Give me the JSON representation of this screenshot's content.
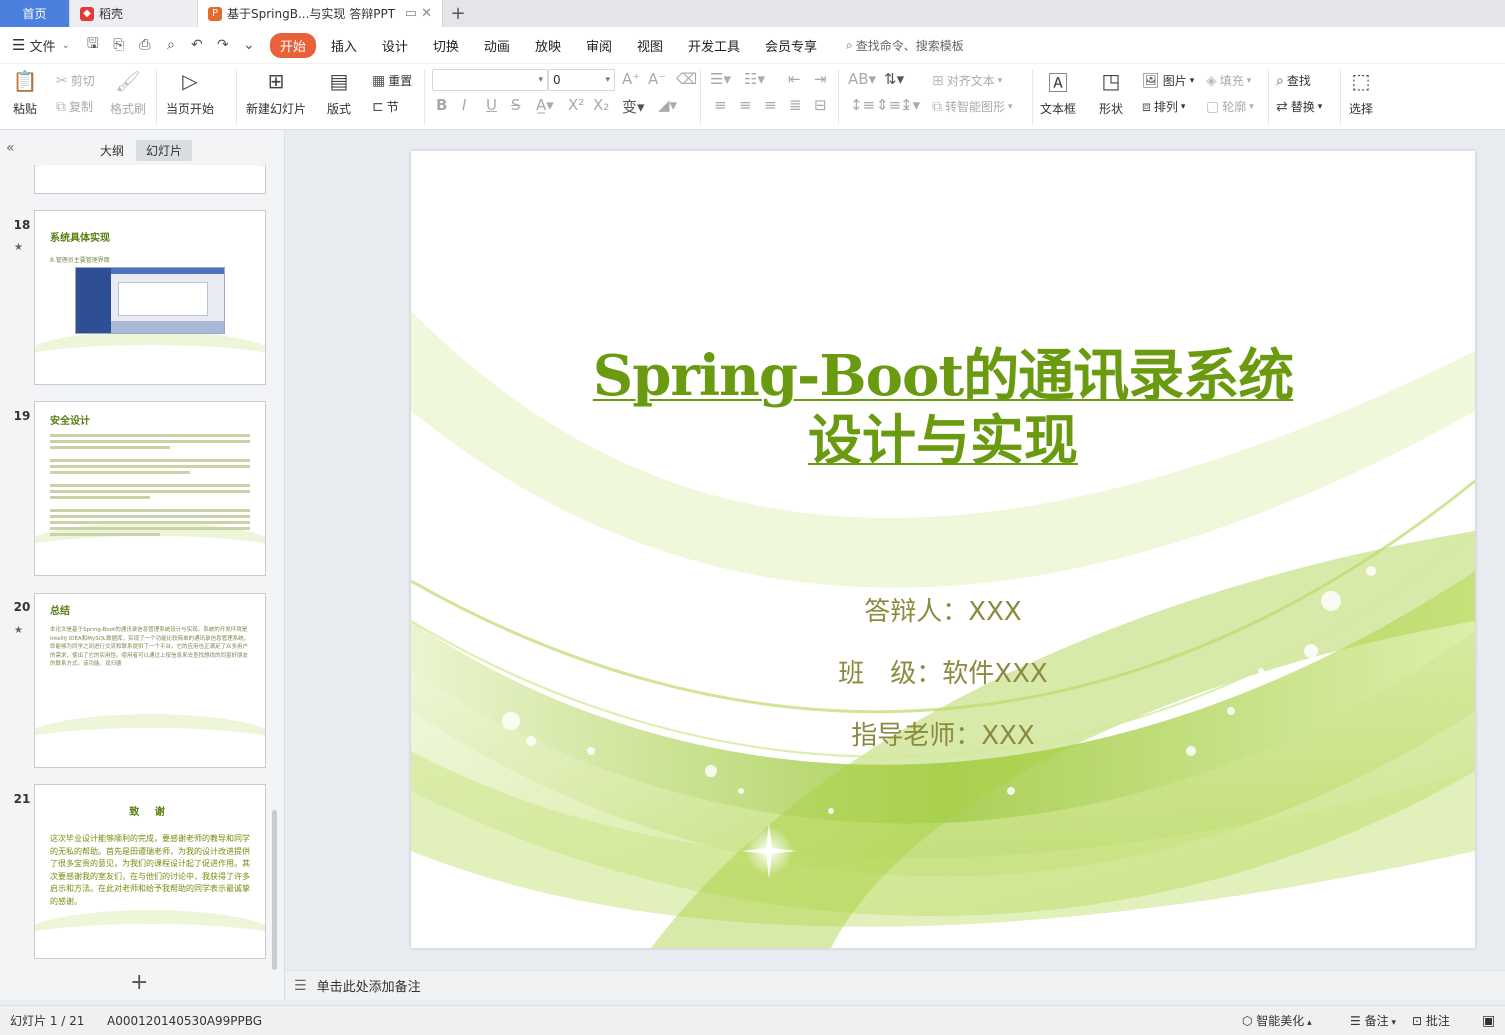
{
  "tabs": {
    "home": "首页",
    "docer": "稻壳",
    "doc": "基于SpringB...与实现 答辩PPT"
  },
  "menu": {
    "file": "文件",
    "tabs": [
      "开始",
      "插入",
      "设计",
      "切换",
      "动画",
      "放映",
      "审阅",
      "视图",
      "开发工具",
      "会员专享"
    ],
    "search": "查找命令、搜索模板"
  },
  "ribbon": {
    "paste": "粘贴",
    "cut": "剪切",
    "copy": "复制",
    "format_painter": "格式刷",
    "from_current": "当页开始",
    "new_slide": "新建幻灯片",
    "layout": "版式",
    "reset": "重置",
    "section": "节",
    "font_size": "0",
    "align_text": "对齐文本",
    "smart_graphic": "转智能图形",
    "textbox": "文本框",
    "shape": "形状",
    "picture": "图片",
    "arrange": "排列",
    "fill": "填充",
    "outline": "轮廓",
    "find": "查找",
    "replace": "替换",
    "select": "选择"
  },
  "left_panel": {
    "tab_outline": "大纲",
    "tab_slides": "幻灯片",
    "slides": [
      {
        "num": "18",
        "title": "系统具体实现",
        "sub": "8.管理员主要管理界面"
      },
      {
        "num": "19",
        "title": "安全设计"
      },
      {
        "num": "20",
        "title": "总结",
        "body": "本论文是基于Spring-Boot的通讯录信息管理系统设计与实现。系统的开发环境是IntelliJ IDEA和MySQL数据库，实现了一个功能比较简单的通讯录信息管理系统，即能够为同学之间进行交流和联系提供了一个平台。它的应用也正满足了众多用户的需求，使出了它的实用性。使用者可以通过上按信息来去查找想找的同窗好朋友的联系方式。该功能。双归德"
      },
      {
        "num": "21",
        "title": "致  谢",
        "body": "这次毕业设计能够顺利的完成，要感谢老师的教导和同学的无私的帮助。首先是田遵瑞老师，为我的设计改进提供了很多宝贵的意见，为我们的课程设计起了促进作用。其次要感谢我的室友们，在与他们的讨论中，我获得了许多启示和方法。在此对老师和给予我帮助的同学表示最诚挚的感谢。"
      }
    ]
  },
  "slide": {
    "title_line1": "Spring-Boot的通讯录系统",
    "title_line2": "设计与实现",
    "presenter": "答辩人：XXX",
    "class": "班　级：软件XXX",
    "advisor": "指导老师：XXX"
  },
  "notes_placeholder": "单击此处添加备注",
  "status": {
    "slide_pos": "幻灯片 1 / 21",
    "doc_id": "A000120140530A99PPBG",
    "beautify": "智能美化",
    "notes": "备注",
    "comment": "批注"
  },
  "colors": {
    "accent": "#e8613a",
    "title_green": "#6a9a10",
    "info_olive": "#8c8a3f"
  }
}
